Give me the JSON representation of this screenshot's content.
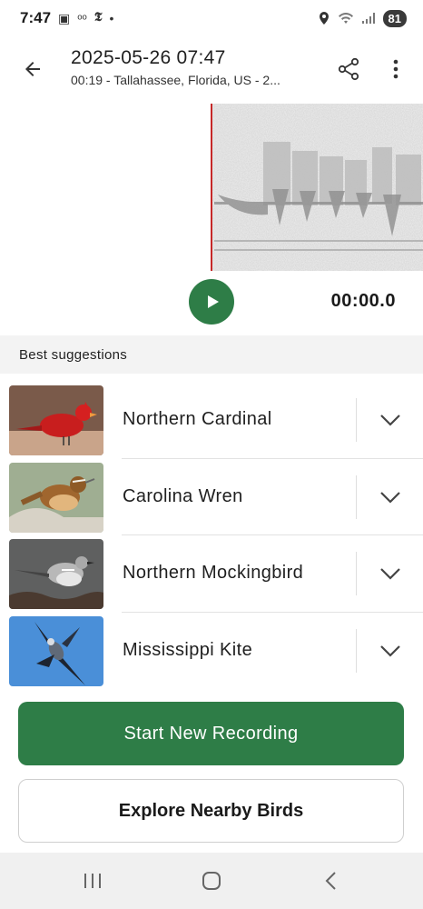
{
  "status_bar": {
    "time": "7:47",
    "battery": "81",
    "left_icons": [
      "screenshot-icon",
      "voicemail-icon",
      "nyt-icon",
      "dot-icon"
    ],
    "right_icons": [
      "location-icon",
      "wifi-icon",
      "signal-icon"
    ]
  },
  "header": {
    "title": "2025-05-26 07:47",
    "subtitle": "00:19 - Tallahassee, Florida, US - 2..."
  },
  "player": {
    "time": "00:00.0"
  },
  "suggestions": {
    "header": "Best suggestions",
    "birds": [
      {
        "name": "Northern Cardinal"
      },
      {
        "name": "Carolina Wren"
      },
      {
        "name": "Northern Mockingbird"
      },
      {
        "name": "Mississippi Kite"
      }
    ]
  },
  "actions": {
    "start_recording": "Start New Recording",
    "explore": "Explore Nearby Birds"
  },
  "colors": {
    "accent": "#2e7d47",
    "playhead": "#c62828"
  }
}
